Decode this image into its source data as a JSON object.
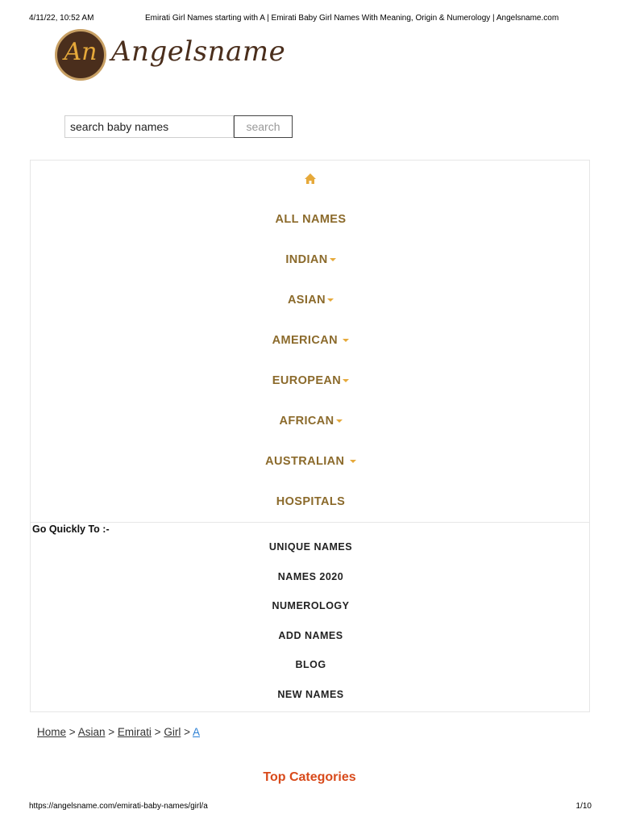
{
  "print": {
    "datetime": "4/11/22, 10:52 AM",
    "title": "Emirati Girl Names starting with A | Emirati Baby Girl Names With Meaning, Origin & Numerology | Angelsname.com",
    "url": "https://angelsname.com/emirati-baby-names/girl/a",
    "page": "1/10"
  },
  "logo": {
    "badge": "An",
    "wordmark": "Angelsname"
  },
  "search": {
    "value": "search baby names",
    "button": "search"
  },
  "nav": {
    "home_icon": "home-icon",
    "items": [
      {
        "label": "ALL NAMES",
        "dropdown": false
      },
      {
        "label": "INDIAN",
        "dropdown": true
      },
      {
        "label": "ASIAN",
        "dropdown": true
      },
      {
        "label": "AMERICAN ",
        "dropdown": true
      },
      {
        "label": "EUROPEAN",
        "dropdown": true
      },
      {
        "label": "AFRICAN",
        "dropdown": true
      },
      {
        "label": "AUSTRALIAN ",
        "dropdown": true
      },
      {
        "label": "HOSPITALS",
        "dropdown": false
      }
    ]
  },
  "quick": {
    "title": "Go Quickly To :-",
    "items": [
      "UNIQUE NAMES",
      "NAMES 2020",
      "NUMEROLOGY",
      "ADD NAMES",
      "BLOG",
      "NEW NAMES"
    ]
  },
  "breadcrumb": {
    "items": [
      "Home",
      "Asian",
      "Emirati",
      "Girl",
      "A"
    ],
    "separator": ">"
  },
  "top_categories": "Top Categories",
  "colors": {
    "nav": "#8b6a2b",
    "accent": "#e6a93a",
    "heading": "#d84a1b",
    "link_current": "#2a7fd4"
  }
}
